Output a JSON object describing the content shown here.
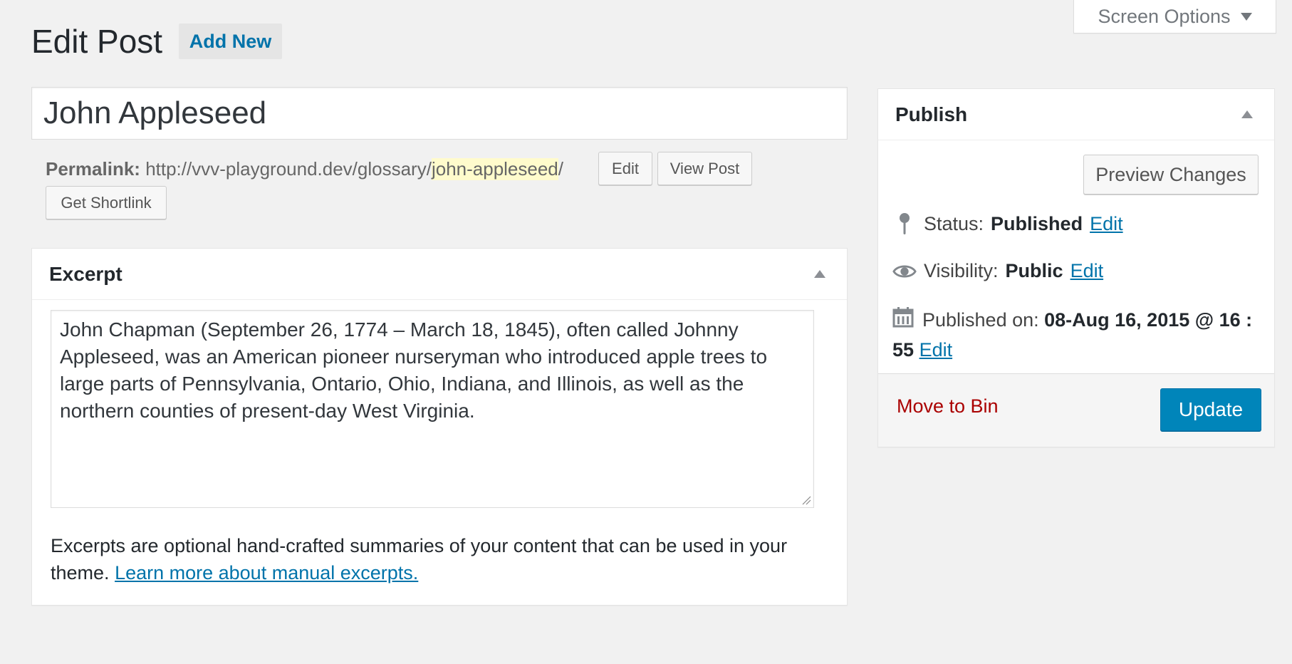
{
  "header": {
    "title": "Edit Post",
    "add_new": "Add New",
    "screen_options": "Screen Options"
  },
  "post": {
    "title": "John Appleseed",
    "permalink_label": "Permalink:",
    "permalink_base": "http://vvv-playground.dev/glossary/",
    "permalink_slug": "john-appleseed",
    "permalink_trailing": "/",
    "edit_button": "Edit",
    "view_post_button": "View Post",
    "shortlink_button": "Get Shortlink"
  },
  "excerpt": {
    "title": "Excerpt",
    "text": "John Chapman (September 26, 1774 – March 18, 1845), often called Johnny Appleseed, was an American pioneer nurseryman who introduced apple trees to large parts of Pennsylvania, Ontario, Ohio, Indiana, and Illinois, as well as the northern counties of present-day West Virginia.",
    "help_text": "Excerpts are optional hand-crafted summaries of your content that can be used in your theme.",
    "help_link": "Learn more about manual excerpts."
  },
  "publish": {
    "title": "Publish",
    "preview_button": "Preview Changes",
    "status_label": "Status:",
    "status_value": "Published",
    "visibility_label": "Visibility:",
    "visibility_value": "Public",
    "published_on_label": "Published on:",
    "published_on_value": "08-Aug 16, 2015 @ 16 : 55",
    "edit_link": "Edit",
    "move_to_bin": "Move to Bin",
    "update_button": "Update"
  },
  "icons": {
    "screen_options": "caret-down-icon",
    "toggle": "caret-up-icon",
    "status": "pin-icon",
    "visibility": "eye-icon",
    "date": "calendar-icon"
  },
  "colors": {
    "link": "#0073aa",
    "primary_button": "#0085ba",
    "delete": "#aa0000",
    "slug_highlight": "#fffbcc"
  }
}
